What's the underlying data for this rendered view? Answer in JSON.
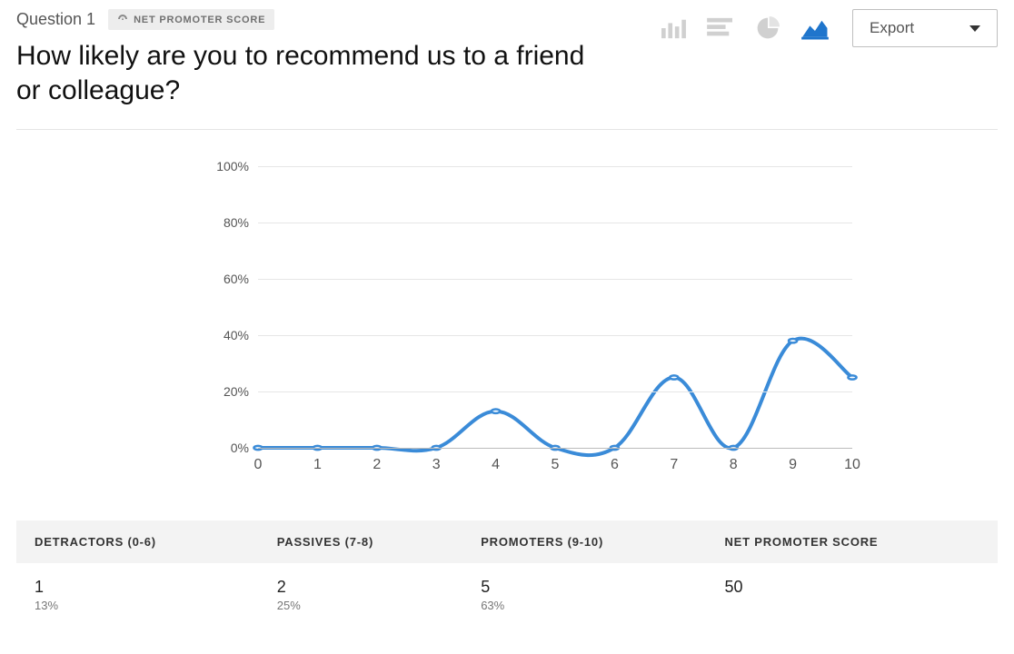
{
  "header": {
    "question_number": "Question 1",
    "badge": "NET PROMOTER SCORE",
    "title": "How likely are you to recommend us to a friend or colleague?",
    "export_label": "Export"
  },
  "chart_types": {
    "bar": "bar-chart",
    "hbar": "horizontal-bar",
    "pie": "pie-chart",
    "area": "area-chart",
    "active": "area"
  },
  "chart_data": {
    "type": "line",
    "title": "",
    "xlabel": "",
    "ylabel": "",
    "ylim": [
      0,
      100
    ],
    "y_ticks": [
      0,
      20,
      40,
      60,
      80,
      100
    ],
    "y_tick_labels": [
      "0%",
      "20%",
      "40%",
      "60%",
      "80%",
      "100%"
    ],
    "categories": [
      0,
      1,
      2,
      3,
      4,
      5,
      6,
      7,
      8,
      9,
      10
    ],
    "values": [
      0,
      0,
      0,
      0,
      13,
      0,
      0,
      25,
      0,
      38,
      25
    ],
    "y_unit": "%"
  },
  "summary": {
    "headers": [
      "DETRACTORS (0-6)",
      "PASSIVES (7-8)",
      "PROMOTERS (9-10)",
      "NET PROMOTER SCORE"
    ],
    "detractors": {
      "count": "1",
      "pct": "13%"
    },
    "passives": {
      "count": "2",
      "pct": "25%"
    },
    "promoters": {
      "count": "5",
      "pct": "63%"
    },
    "nps": "50"
  }
}
